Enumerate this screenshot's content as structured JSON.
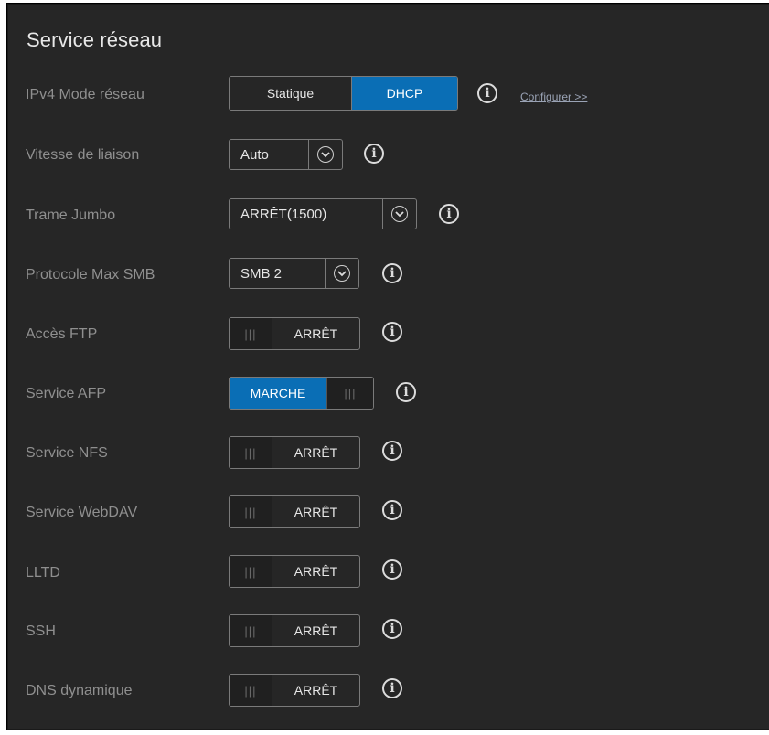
{
  "title": "Service réseau",
  "rows": {
    "ipv4": {
      "label": "IPv4 Mode réseau",
      "options": [
        "Statique",
        "DHCP"
      ],
      "selected": "DHCP",
      "link": "Configurer >>"
    },
    "link_speed": {
      "label": "Vitesse de liaison",
      "value": "Auto"
    },
    "jumbo": {
      "label": "Trame Jumbo",
      "value": "ARRÊT(1500)"
    },
    "smb": {
      "label": "Protocole Max SMB",
      "value": "SMB 2"
    },
    "ftp": {
      "label": "Accès FTP",
      "state": "ARRÊT"
    },
    "afp": {
      "label": "Service AFP",
      "state": "MARCHE"
    },
    "nfs": {
      "label": "Service NFS",
      "state": "ARRÊT"
    },
    "webdav": {
      "label": "Service WebDAV",
      "state": "ARRÊT"
    },
    "lltd": {
      "label": "LLTD",
      "state": "ARRÊT"
    },
    "ssh": {
      "label": "SSH",
      "state": "ARRÊT"
    },
    "ddns": {
      "label": "DNS dynamique",
      "state": "ARRÊT"
    }
  },
  "toggle_grip": "|||",
  "info_glyph": "i",
  "icons": {
    "info": "info-icon",
    "chevron": "chevron-down-icon",
    "grip": "toggle-grip-icon"
  },
  "colors": {
    "background": "#262626",
    "accent": "#0a6eb5",
    "label": "#8f8f8f",
    "text": "#e6e6e6"
  }
}
